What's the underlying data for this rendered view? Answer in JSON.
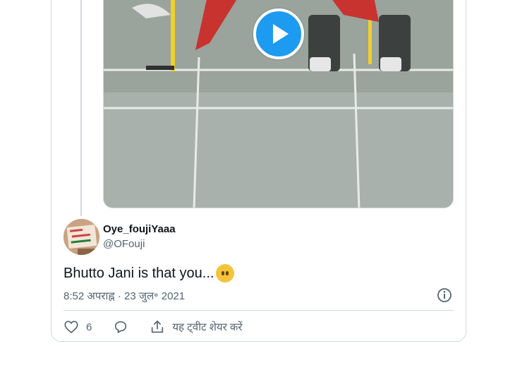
{
  "tweet": {
    "display_name": "Oye_foujiYaaa",
    "handle": "@OFouji",
    "text": "Bhutto Jani is that you...",
    "emoji": "neutral-face-no-mouth",
    "timestamp": "8:52 अपराह्न · 23 जुल॰ 2021",
    "likes": "6",
    "share_label": "यह ट्वीट शेयर करें",
    "avatar_sign_text": [
      "PAKIS",
      "STANDS WITH",
      "PALESTINE"
    ]
  },
  "video": {
    "play_icon": "play-icon"
  },
  "colors": {
    "accent": "#1d9bf0",
    "text_primary": "#0f1419",
    "text_secondary": "#536471",
    "border": "#cfd9de"
  },
  "icons": [
    "play-icon",
    "info-icon",
    "heart-icon",
    "reply-icon",
    "share-icon"
  ]
}
